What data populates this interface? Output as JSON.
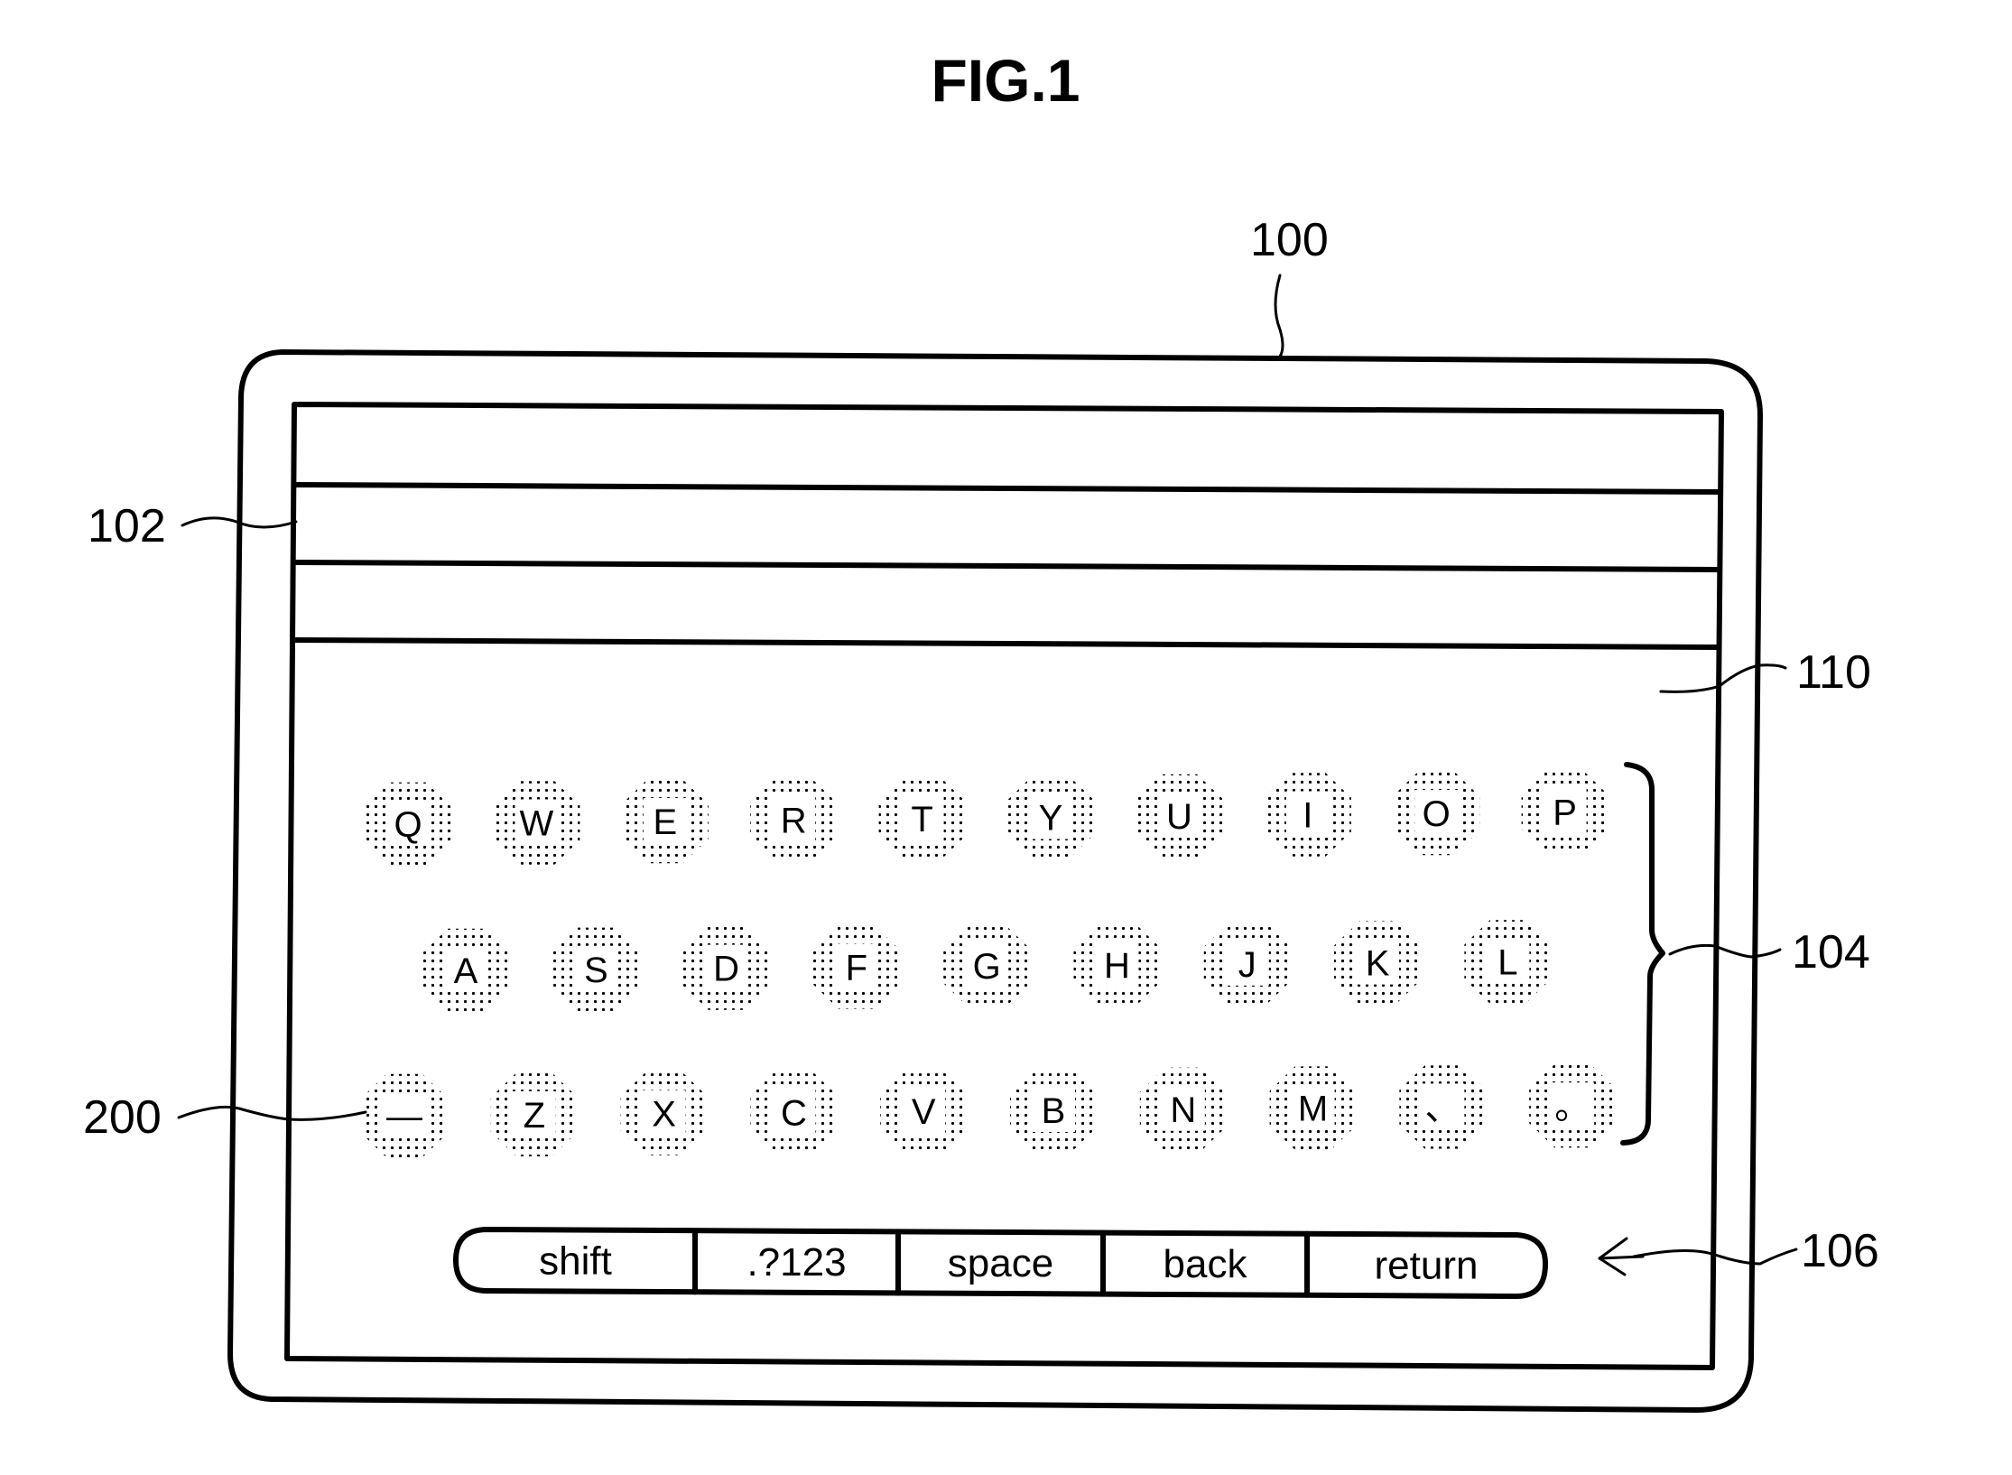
{
  "figure": {
    "title": "FIG.1"
  },
  "reference_labels": {
    "device": "100",
    "text_area": "102",
    "keyboard": "104",
    "function_bar": "106",
    "screen": "110",
    "key_element": "200"
  },
  "keyboard": {
    "rows": [
      [
        "Q",
        "W",
        "E",
        "R",
        "T",
        "Y",
        "U",
        "I",
        "O",
        "P"
      ],
      [
        "A",
        "S",
        "D",
        "F",
        "G",
        "H",
        "J",
        "K",
        "L"
      ],
      [
        "—",
        "Z",
        "X",
        "C",
        "V",
        "B",
        "N",
        "M",
        "、",
        "。"
      ]
    ]
  },
  "function_bar": {
    "buttons": [
      "shift",
      ".?123",
      "space",
      "back",
      "return"
    ]
  },
  "colors": {
    "ink": "#000000",
    "paper": "#ffffff"
  }
}
